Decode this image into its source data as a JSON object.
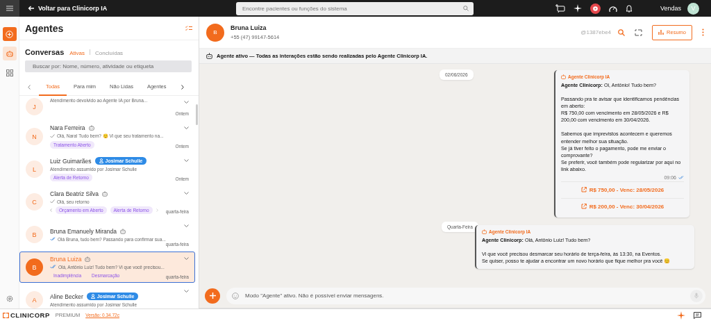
{
  "topbar": {
    "back_label": "Voltar para Clinicorp IA",
    "search_placeholder": "Encontre pacientes ou funções do sistema",
    "user_name": "Vendas",
    "user_initial": "V"
  },
  "sidebar": {
    "title": "Agentes",
    "section_title": "Conversas",
    "filters": [
      {
        "label": "Ativas",
        "selected": true
      },
      {
        "label": "Concluídas",
        "selected": false
      }
    ],
    "search_placeholder": "Buscar por: Nome, número, atividade ou etiqueta",
    "tabs": [
      {
        "label": "Todas",
        "selected": true
      },
      {
        "label": "Para mim",
        "selected": false
      },
      {
        "label": "Não Lidas",
        "selected": false
      },
      {
        "label": "Agentes",
        "selected": false
      }
    ],
    "conversations": [
      {
        "initial": "J",
        "preview": "Atendimento devolvido ao Agente IA por Bruna...",
        "time": "Ontem",
        "selected": false
      },
      {
        "initial": "N",
        "name": "Nara Ferreira",
        "bot": true,
        "checkmark": true,
        "read": false,
        "preview": "Olá, Nara! Tudo bem? 😊 Vi que seu tratamento na...",
        "tags": [
          "Tratamento Aberto"
        ],
        "time": "Ontem",
        "selected": false
      },
      {
        "initial": "L",
        "name": "Luiz Guimarães",
        "agent": "Josimar Schulle",
        "preview": "Atendimento assumido por Josimar Schulle",
        "tags": [
          "Alerta de Retorno"
        ],
        "time": "Ontem",
        "selected": false
      },
      {
        "initial": "C",
        "name": "Clara Beatriz Silva",
        "bot": true,
        "checkmark": true,
        "read": false,
        "preview": "Olá, seu retorno",
        "tags": [
          "Orçamento em Aberto",
          "Alerta de Retorno"
        ],
        "tag_arrows": true,
        "time": "quarta-feira",
        "selected": false
      },
      {
        "initial": "B",
        "name": "Bruna Emanuely Miranda",
        "bot": true,
        "checkmark": true,
        "read": true,
        "preview": "Olá Bruna, tudo bem? Passando para confirmar sua...",
        "time": "quarta-feira",
        "selected": false
      },
      {
        "initial": "B",
        "name": "Bruna Luiza",
        "bot": true,
        "checkmark": true,
        "read": true,
        "preview": "Olá, Antônio Luiz! Tudo bem? Vi que você precisou...",
        "tags": [
          "Inadimplência",
          "Desmarcação"
        ],
        "time": "quarta-feira",
        "selected": true
      },
      {
        "initial": "A",
        "name": "Aline Becker",
        "agent": "Josimar Schulle",
        "preview": "Atendimento assumido por Josimar Schulle",
        "selected": false
      }
    ]
  },
  "chat": {
    "contact_initial": "B",
    "contact_name": "Bruna Luiza",
    "phone": "+55 (47) 99147-5614",
    "handle": "@1387ebe4",
    "summary_button": "Resumo",
    "banner": "Agente ativo — Todas as interações estão sendo realizadas pelo Agente Clinicorp IA.",
    "messages": [
      {
        "kind": "date",
        "text": "02/06/2026"
      },
      {
        "kind": "bubble",
        "sender": "Agente Clinicorp IA",
        "paragraphs": [
          "**Agente Clinicorp:** Oi, Antônio! Tudo bem?",
          "Passando pra te avisar que identificamos pendências em aberto:\nR$ 750,00 com vencimento em 28/05/2026 e R$ 200,00 com vencimento em 30/04/2026.",
          "Sabemos que imprevistos acontecem e queremos entender melhor sua situação.\nSe já tiver feito o pagamento, pode me enviar o comprovante?\nSe preferir, você também pode regularizar por aqui no link abaixo."
        ],
        "time": "09:06",
        "links": [
          "R$ 750,00 - Venc: 28/05/2026",
          "R$ 200,00 - Venc: 30/04/2026"
        ]
      },
      {
        "kind": "date",
        "text": "Quarta-Feira"
      },
      {
        "kind": "bubble",
        "sender": "Agente Clinicorp IA",
        "paragraphs": [
          "**Agente Clinicorp:** Olá, Antônio Luiz! Tudo bem?",
          "Vi que você precisou desmarcar seu horário de terça-feira, às 13:30, na Eventos.\nSe quiser, posso te ajudar a encontrar um novo horário que fique melhor pra você 😊"
        ]
      }
    ],
    "composer_placeholder": "Modo \"Agente\" ativo. Não é possível enviar mensagens."
  },
  "footer": {
    "brand": "CLINICORP",
    "plan": "PREMIUM",
    "version": "Versão: 0.34.72c"
  }
}
